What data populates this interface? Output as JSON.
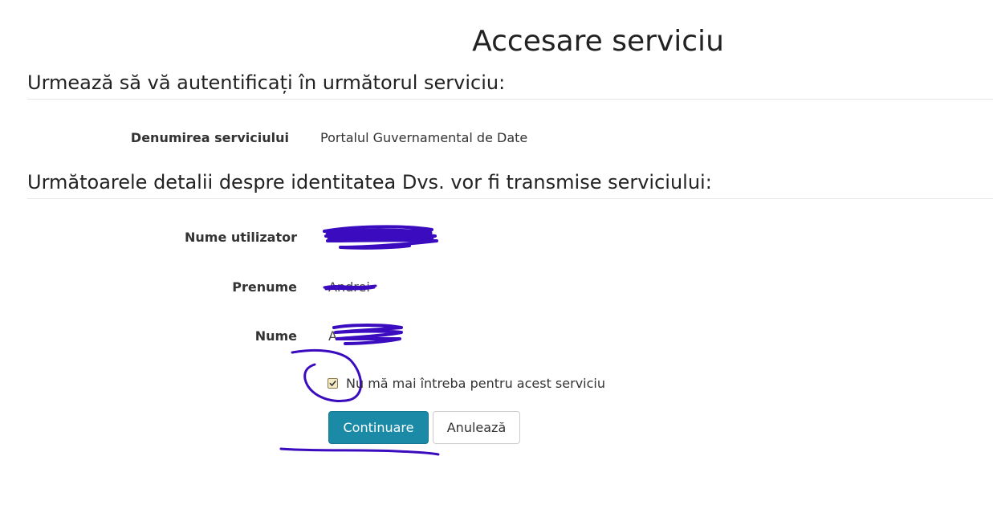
{
  "page": {
    "title": "Accesare serviciu"
  },
  "service_section": {
    "heading": "Urmează să vă autentificați în următorul serviciu:",
    "label": "Denumirea serviciului",
    "value": "Portalul Guvernamental de Date"
  },
  "identity_section": {
    "heading": "Următoarele detalii despre identitatea Dvs. vor fi transmise serviciului:",
    "fields": [
      {
        "label": "Nume utilizator",
        "value": "A"
      },
      {
        "label": "Prenume",
        "value": "Andrei"
      },
      {
        "label": "Nume",
        "value": "A"
      }
    ]
  },
  "consent": {
    "checked": true,
    "label": "Nu mă mai întreba pentru acest serviciu"
  },
  "actions": {
    "continue_label": "Continuare",
    "cancel_label": "Anulează"
  },
  "colors": {
    "primary": "#1b8aa7",
    "annotation": "#3a0bbf"
  }
}
